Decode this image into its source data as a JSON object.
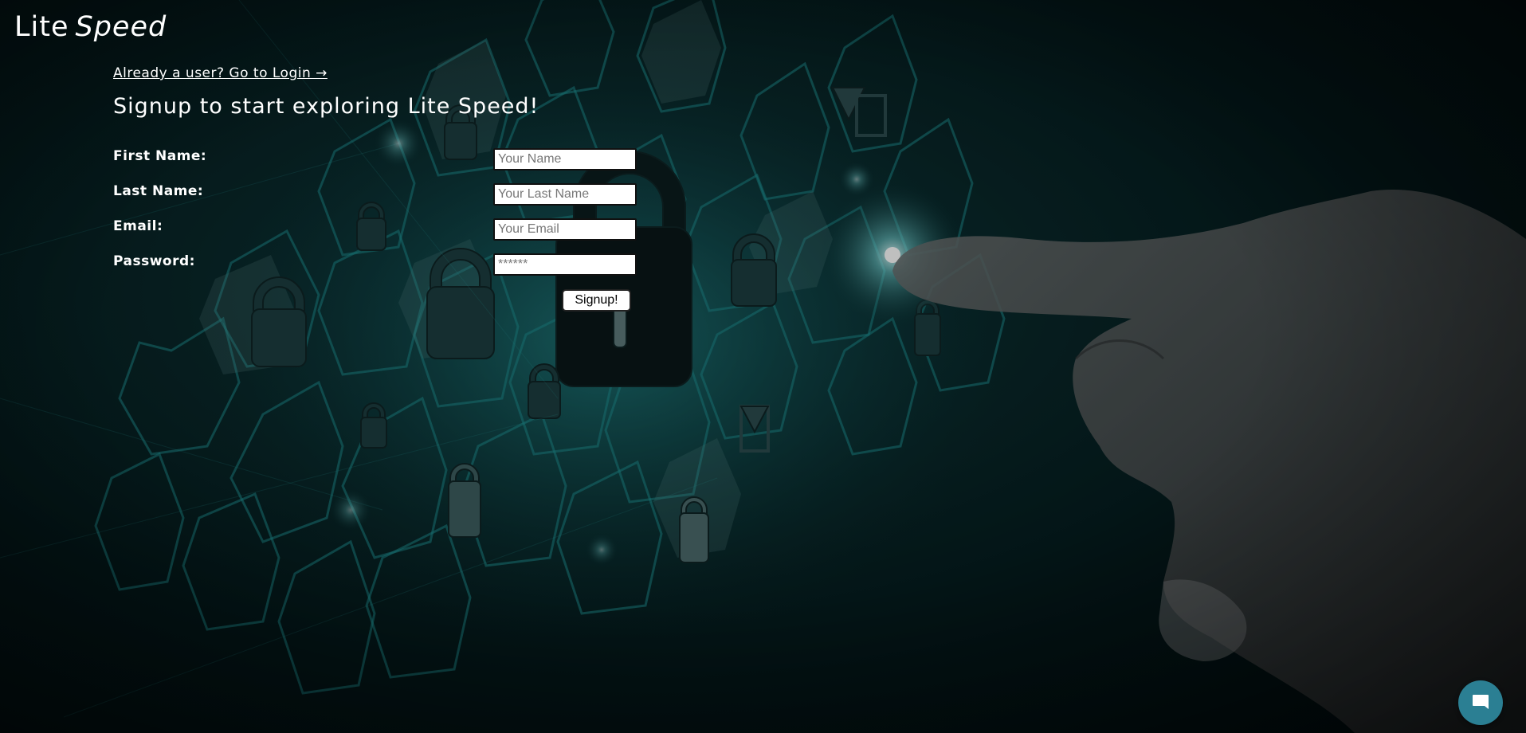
{
  "brand": {
    "word1": "Lite",
    "word2": "Speed"
  },
  "login_link": "Already a user? Go to Login →",
  "heading": "Signup to start exploring Lite Speed!",
  "form": {
    "first_name": {
      "label": "First Name:",
      "placeholder": "Your Name",
      "value": ""
    },
    "last_name": {
      "label": "Last Name:",
      "placeholder": "Your Last Name",
      "value": ""
    },
    "email": {
      "label": "Email:",
      "placeholder": "Your Email",
      "value": ""
    },
    "password": {
      "label": "Password:",
      "placeholder": "******",
      "value": ""
    },
    "submit_label": "Signup!"
  },
  "chat": {
    "icon": "chat-bubble-icon"
  },
  "colors": {
    "background_dark": "#02111a",
    "accent_teal": "#1fa3a6",
    "chat_button": "#2b7f93",
    "text": "#ffffff"
  }
}
